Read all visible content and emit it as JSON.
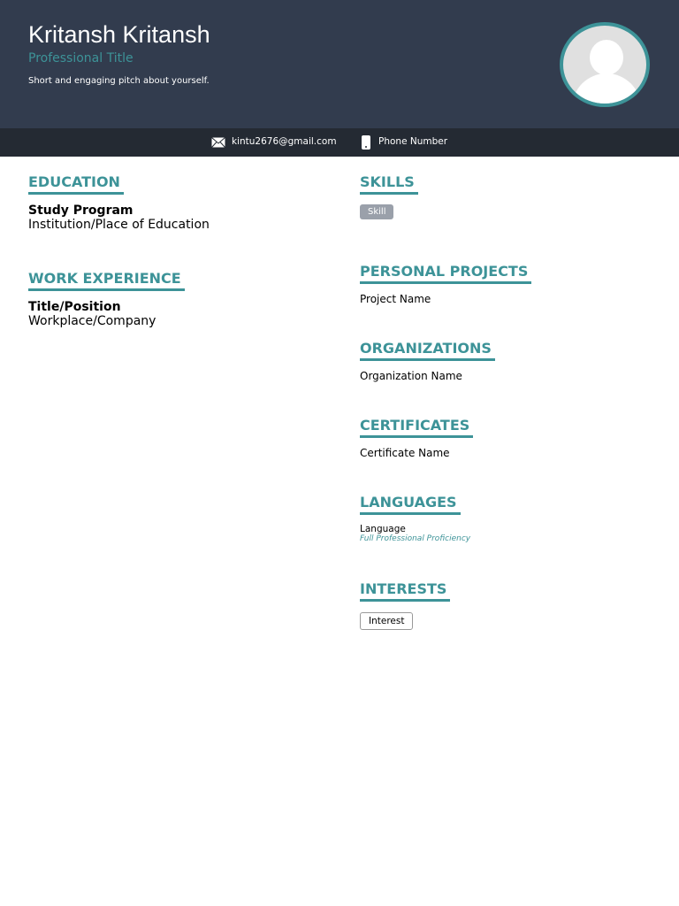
{
  "header": {
    "name": "Kritansh Kritansh",
    "title": "Professional Title",
    "pitch": "Short and engaging pitch about yourself."
  },
  "contact": {
    "email": "kintu2676@gmail.com",
    "phone": "Phone Number"
  },
  "education": {
    "heading": "EDUCATION",
    "program": "Study Program",
    "institution": "Institution/Place of Education"
  },
  "work": {
    "heading": "WORK EXPERIENCE",
    "title": "Title/Position",
    "company": "Workplace/Company"
  },
  "skills": {
    "heading": "SKILLS",
    "items": [
      "Skill"
    ]
  },
  "projects": {
    "heading": "PERSONAL PROJECTS",
    "name": "Project Name"
  },
  "organizations": {
    "heading": "ORGANIZATIONS",
    "name": "Organization Name"
  },
  "certificates": {
    "heading": "CERTIFICATES",
    "name": "Certificate Name"
  },
  "languages": {
    "heading": "LANGUAGES",
    "name": "Language",
    "level": "Full Professional Proficiency"
  },
  "interests": {
    "heading": "INTERESTS",
    "items": [
      "Interest"
    ]
  }
}
